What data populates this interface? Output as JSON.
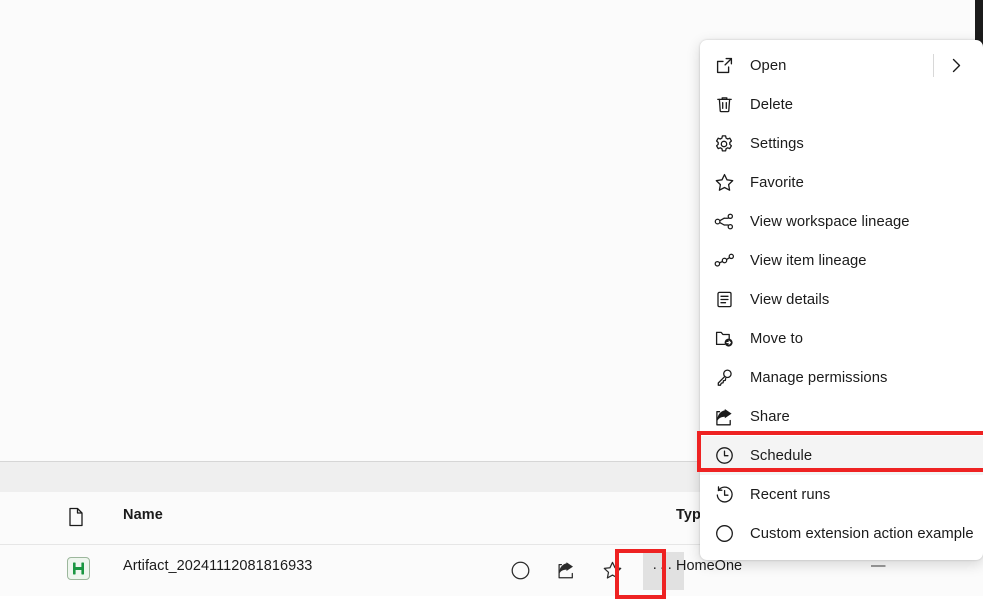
{
  "window": {
    "background_color": "#fbfbfb"
  },
  "context_menu": {
    "items": [
      {
        "label": "Open",
        "icon": "open-external-icon",
        "has_submenu": true
      },
      {
        "label": "Delete",
        "icon": "trash-icon",
        "has_submenu": false
      },
      {
        "label": "Settings",
        "icon": "gear-icon",
        "has_submenu": false
      },
      {
        "label": "Favorite",
        "icon": "star-icon",
        "has_submenu": false
      },
      {
        "label": "View workspace lineage",
        "icon": "workspace-lineage-icon",
        "has_submenu": false
      },
      {
        "label": "View item lineage",
        "icon": "item-lineage-icon",
        "has_submenu": false
      },
      {
        "label": "View details",
        "icon": "details-document-icon",
        "has_submenu": false
      },
      {
        "label": "Move to",
        "icon": "move-to-folder-icon",
        "has_submenu": false
      },
      {
        "label": "Manage permissions",
        "icon": "key-icon",
        "has_submenu": false
      },
      {
        "label": "Share",
        "icon": "share-icon",
        "has_submenu": false
      },
      {
        "label": "Schedule",
        "icon": "clock-icon",
        "has_submenu": false,
        "highlighted": true
      },
      {
        "label": "Recent runs",
        "icon": "history-icon",
        "has_submenu": false
      },
      {
        "label": "Custom extension action example",
        "icon": "circle-icon",
        "has_submenu": false
      }
    ]
  },
  "list": {
    "columns": {
      "icon": "document-icon",
      "name": "Name",
      "type": "Typ"
    },
    "row": {
      "filetype_icon": "green-report-icon",
      "name": "Artifact_20241112081816933",
      "workspace": "HomeOne",
      "refreshed": "—",
      "actions": {
        "status": "circle-icon",
        "share": "share-icon",
        "favorite": "star-icon",
        "more": "···"
      }
    }
  },
  "annotations": {
    "highlight_color": "#ee2222",
    "boxes": [
      {
        "target": "more-options-button"
      },
      {
        "target": "schedule-menu-item"
      }
    ]
  }
}
